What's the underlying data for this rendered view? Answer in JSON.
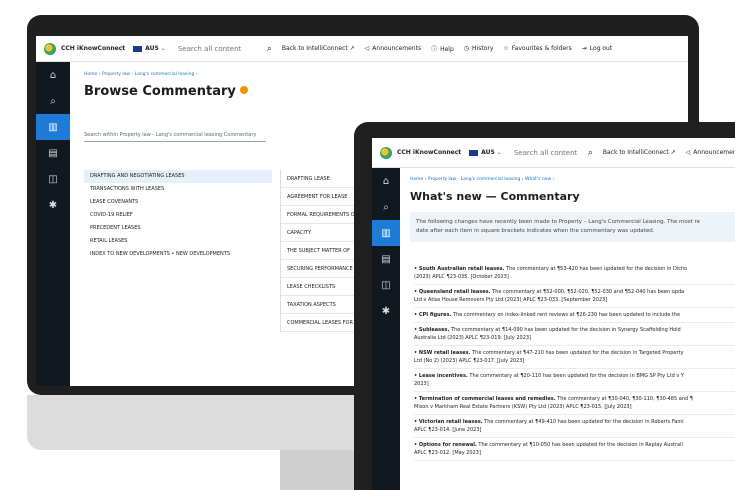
{
  "app": {
    "brand": "CCH iKnowConnect",
    "region": "AUS",
    "search_placeholder": "Search all content"
  },
  "nav": {
    "back": "Back to IntelliConnect",
    "announcements": "Announcements",
    "help": "Help",
    "history": "History",
    "favourites": "Favourites & folders",
    "logout": "Log out"
  },
  "browse": {
    "breadcrumb": "Home  ›  Property law - Lang's commercial leasing  ›",
    "title": "Browse Commentary",
    "search_within": "Search within Property law - Lang's commercial leasing Commentary",
    "left_items": [
      "DRAFTING AND NEGOTIATING LEASES",
      "TRANSACTIONS WITH LEASES",
      "LEASE COVENANTS",
      "COVID-19 RELIEF",
      "PRECEDENT LEASES",
      "RETAIL LEASES",
      "INDEX TO NEW DEVELOPMENTS • NEW DEVELOPMENTS"
    ],
    "right_items": [
      "DRAFTING LEASE",
      "AGREEMENT FOR LEASE",
      "FORMAL REQUIREMENTS O",
      "CAPACITY",
      "THE SUBJECT MATTER OF",
      "SECURING PERFORMANCE",
      "LEASE CHECKLISTS",
      "TAXATION ASPECTS",
      "COMMERCIAL LEASES FOR T"
    ]
  },
  "whatsnew": {
    "breadcrumb": "Home  ›  Property law - Lang's commercial leasing  ›  What's new  ›",
    "title": "What's new — Commentary",
    "intro_1": "The following changes have recently been made to Property – Lang's Commercial Leasing. The most re",
    "intro_2": "date after each item in square brackets indicates when the commentary was updated.",
    "entries": [
      {
        "head": "• South Australian retail leases.",
        "text": " The commentary at ¶53-420 has been updated for the decision in Dicho",
        "line2": "(2023) APLC ¶23-035. [October 2023]"
      },
      {
        "head": "• Queensland retail leases.",
        "text": " The commentary at ¶52-000, ¶52-020, ¶52-030 and ¶52-040 has been upda",
        "line2": "Ltd v Atlas House Removers Pty Ltd (2023) APLC ¶23-033. [September 2023]"
      },
      {
        "head": "• CPI figures.",
        "text": " The commentary on index-linked rent reviews at ¶26-230 has been updated to include the",
        "line2": ""
      },
      {
        "head": "• Subleases.",
        "text": " The commentary at ¶14-090 has been updated for the decision in Synergy Scaffolding Hold",
        "line2": "Australia Ltd (2023) APLC ¶23-019. [July 2023]"
      },
      {
        "head": "• NSW retail leases.",
        "text": " The commentary at ¶47-210 has been updated for the decision in Targeted Property",
        "line2": "Ltd (No 2) (2023) APLC ¶23-017. [July 2023]"
      },
      {
        "head": "• Lease incentives.",
        "text": " The commentary at ¶20-110 has been updated for the decision in BMG SP Pty Ltd v Y",
        "line2": "2023]"
      },
      {
        "head": "• Termination of commercial leases and remedies.",
        "text": " The commentary at ¶30-040, ¶30-110, ¶30-485 and ¶",
        "line2": "Mison v Markham Real Estate Partners (KSW) Pty Ltd (2023) APLC ¶23-015. [July 2023]"
      },
      {
        "head": "• Victorian retail leases.",
        "text": " The commentary at ¶49-410 has been updated for the decision in Roberts Fami",
        "line2": "APLC ¶23-014. [June 2023]"
      },
      {
        "head": "• Options for renewal.",
        "text": " The commentary at ¶10-050 has been updated for the decision in Replay Australi",
        "line2": "APLC ¶23-012. [May 2023]"
      }
    ]
  }
}
